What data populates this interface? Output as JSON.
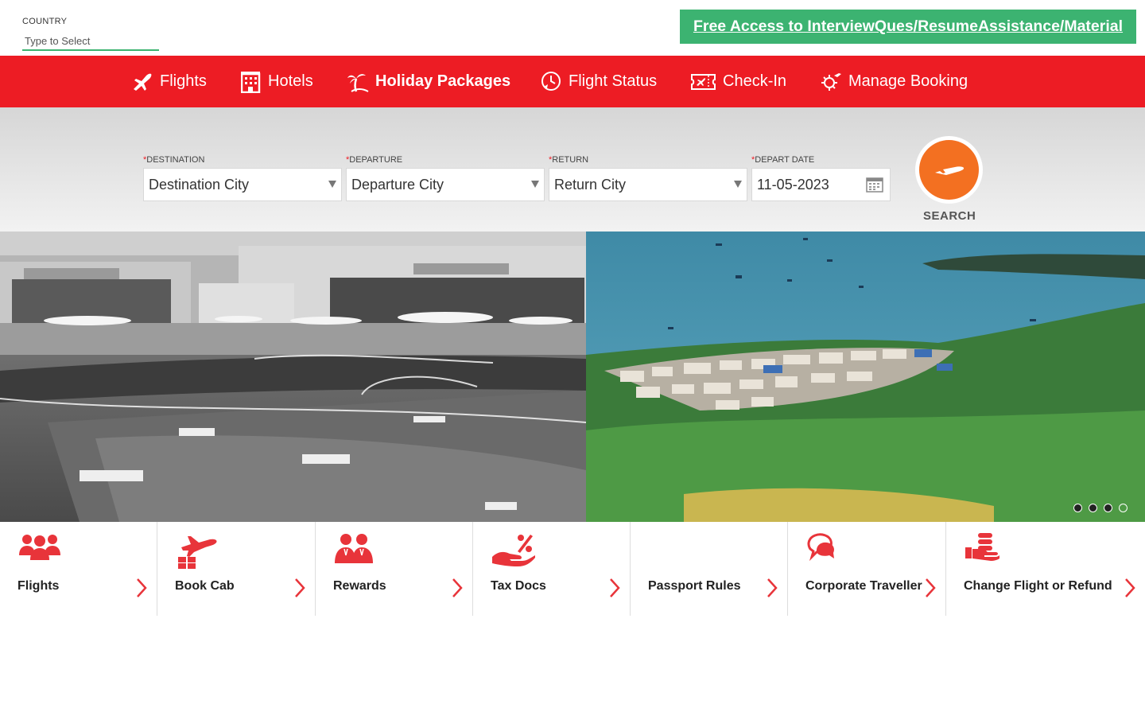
{
  "country": {
    "label": "COUNTRY",
    "placeholder": "Type to Select"
  },
  "promo": {
    "text": "Free Access to InterviewQues/ResumeAssistance/Material",
    "color": "#3cb371"
  },
  "nav": {
    "accent": "#ed1c24",
    "items": [
      {
        "label": "Flights",
        "icon": "plane-icon"
      },
      {
        "label": "Hotels",
        "icon": "hotel-building-icon"
      },
      {
        "label": "Holiday Packages",
        "icon": "palm-tree-icon",
        "active": true
      },
      {
        "label": "Flight Status",
        "icon": "clock-plane-icon"
      },
      {
        "label": "Check-In",
        "icon": "ticket-icon"
      },
      {
        "label": "Manage Booking",
        "icon": "gear-plane-icon"
      }
    ]
  },
  "search": {
    "required_mark": "*",
    "destination": {
      "label": "DESTINATION",
      "value": "Destination City"
    },
    "departure": {
      "label": "DEPARTURE",
      "value": "Departure City"
    },
    "return": {
      "label": "RETURN",
      "value": "Return City"
    },
    "depart_date": {
      "label": "DEPART DATE",
      "value": "11-05-2023"
    },
    "button_label": "SEARCH",
    "button_color": "#f37021"
  },
  "banner": {
    "slides": 4,
    "active_slide": 4
  },
  "quick_links": [
    {
      "label": "Flights",
      "icon": "group-users-icon"
    },
    {
      "label": "Book Cab",
      "icon": "plane-luggage-icon"
    },
    {
      "label": "Rewards",
      "icon": "two-people-icon"
    },
    {
      "label": "Tax Docs",
      "icon": "percent-hand-icon"
    },
    {
      "label": "Passport Rules",
      "icon": ""
    },
    {
      "label": "Corporate Traveller",
      "icon": "chat-bubbles-icon"
    },
    {
      "label": "Change Flight or Refund",
      "icon": "hand-coins-icon"
    }
  ]
}
